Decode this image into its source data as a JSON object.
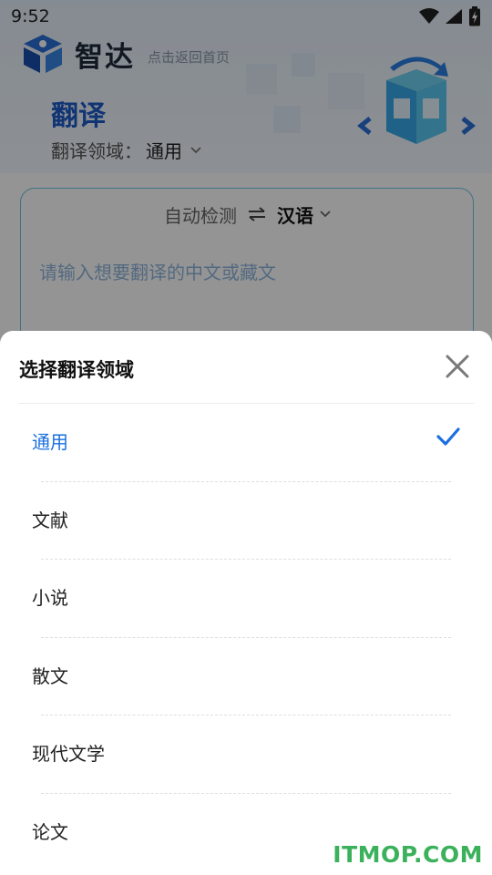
{
  "status_bar": {
    "time": "9:52"
  },
  "header": {
    "brand_name": "智达",
    "back_home": "点击返回首页",
    "page_title": "翻译",
    "domain_label": "翻译领域：",
    "domain_value": "通用"
  },
  "translator": {
    "source_lang": "自动检测",
    "target_lang": "汉语",
    "input_placeholder": "请输入想要翻译的中文或藏文",
    "input_value": ""
  },
  "sheet": {
    "title": "选择翻译领域",
    "options": [
      {
        "label": "通用",
        "selected": true
      },
      {
        "label": "文献",
        "selected": false
      },
      {
        "label": "小说",
        "selected": false
      },
      {
        "label": "散文",
        "selected": false
      },
      {
        "label": "现代文学",
        "selected": false
      },
      {
        "label": "论文",
        "selected": false
      }
    ]
  },
  "colors": {
    "accent": "#1a6fe0",
    "title_blue": "#1e5cc8",
    "card_border": "#6fc3e8",
    "watermark": "#3cb15c"
  },
  "icons": {
    "close": "close-icon",
    "check": "check-icon",
    "swap": "swap-arrows-icon",
    "chevron": "chevron-down-icon"
  },
  "watermark": "ITMOP.COM"
}
